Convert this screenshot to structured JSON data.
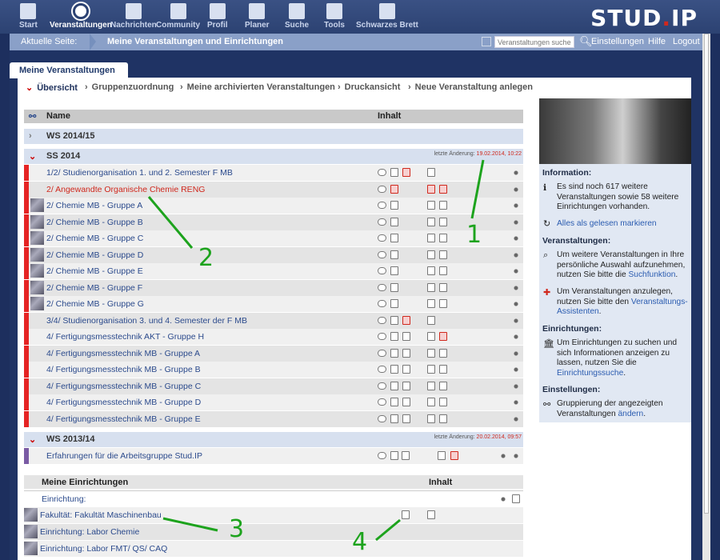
{
  "nav": {
    "items": [
      {
        "label": "Start",
        "icon": "home-icon"
      },
      {
        "label": "Veranstaltungen",
        "icon": "seminar-icon",
        "active": true
      },
      {
        "label": "Nachrichten",
        "icon": "mail-icon"
      },
      {
        "label": "Community",
        "icon": "community-icon"
      },
      {
        "label": "Profil",
        "icon": "profile-icon"
      },
      {
        "label": "Planer",
        "icon": "calendar-icon"
      },
      {
        "label": "Suche",
        "icon": "search-icon"
      },
      {
        "label": "Tools",
        "icon": "tools-icon"
      },
      {
        "label": "Schwarzes Brett",
        "icon": "board-icon"
      }
    ],
    "logo_a": "STUD",
    "logo_dot": ".",
    "logo_b": "IP"
  },
  "crumb": {
    "label": "Aktuelle Seite:",
    "current": "Meine Veranstaltungen und Einrichtungen",
    "search_placeholder": "Veranstaltungen suchen",
    "einstellungen": "Einstellungen",
    "hilfe": "Hilfe",
    "logout": "Logout"
  },
  "tab": "Meine Veranstaltungen",
  "subnav": [
    "Übersicht",
    "Gruppenzuordnung",
    "Meine archivierten Veranstaltungen",
    "Druckansicht",
    "Neue Veranstaltung anlegen"
  ],
  "table": {
    "col_name": "Name",
    "col_inhalt": "Inhalt",
    "ws1415": "WS 2014/15",
    "ss2014": "SS 2014",
    "ss2014_change_label": "letzte Änderung:",
    "ss2014_change_date": "19.02.2014, 10:22",
    "ss2014_rows": [
      "1/2/ Studienorganisation 1. und 2. Semester F MB",
      "2/ Angewandte Organische Chemie RENG",
      "2/ Chemie MB - Gruppe A",
      "2/ Chemie MB - Gruppe B",
      "2/ Chemie MB - Gruppe C",
      "2/ Chemie MB - Gruppe D",
      "2/ Chemie MB - Gruppe E",
      "2/ Chemie MB - Gruppe F",
      "2/ Chemie MB - Gruppe G",
      "3/4/ Studienorganisation 3. und 4. Semester der F MB",
      "4/ Fertigungsmesstechnik AKT - Gruppe H",
      "4/ Fertigungsmesstechnik MB - Gruppe A",
      "4/ Fertigungsmesstechnik MB - Gruppe B",
      "4/ Fertigungsmesstechnik MB - Gruppe C",
      "4/ Fertigungsmesstechnik MB - Gruppe D",
      "4/ Fertigungsmesstechnik MB - Gruppe E"
    ],
    "ws1314": "WS 2013/14",
    "ws1314_change_label": "letzte Änderung:",
    "ws1314_change_date": "20.02.2014, 09:57",
    "ws1314_rows": [
      "Erfahrungen für die Arbeitsgruppe Stud.IP"
    ],
    "inst_header": "Meine Einrichtungen",
    "inst_inhalt": "Inhalt",
    "inst_label": "Einrichtung:",
    "inst_rows": [
      "Fakultät: Fakultät Maschinenbau",
      "Einrichtung: Labor Chemie",
      "Einrichtung: Labor FMT/ QS/ CAQ"
    ]
  },
  "sidebar": {
    "info_h": "Information:",
    "info_p": "Es sind noch 617 weitere Veranstaltungen sowie 58 weitere Einrichtungen vorhanden.",
    "mark_read": "Alles als gelesen markieren",
    "va_h": "Veranstaltungen:",
    "va_p1": "Um weitere Veranstaltungen in Ihre persönliche Auswahl aufzunehmen, nutzen Sie bitte die",
    "va_p1_link": "Suchfunktion",
    "va_p2": "Um Veranstaltungen anzulegen, nutzen Sie bitte den",
    "va_p2_link": "Veranstaltungs-Assistenten",
    "ei_h": "Einrichtungen:",
    "ei_p": "Um Einrichtungen zu suchen und sich Informationen anzeigen zu lassen, nutzen Sie die",
    "ei_p_link": "Einrichtungssuche",
    "es_h": "Einstellungen:",
    "es_p": "Gruppierung der angezeigten Veranstaltungen",
    "es_p_link": "ändern"
  },
  "annotations": [
    "1",
    "2",
    "3",
    "4"
  ]
}
